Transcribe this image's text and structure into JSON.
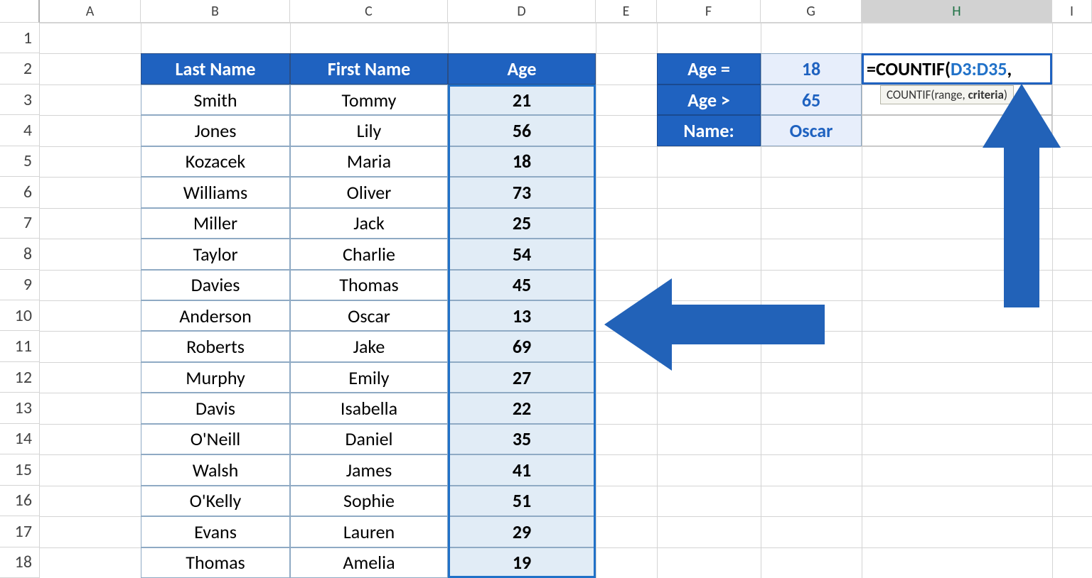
{
  "columns": {
    "A": "A",
    "B": "B",
    "C": "C",
    "D": "D",
    "E": "E",
    "F": "F",
    "G": "G",
    "H": "H",
    "I": "I"
  },
  "rows": [
    "1",
    "2",
    "3",
    "4",
    "5",
    "6",
    "7",
    "8",
    "9",
    "10",
    "11",
    "12",
    "13",
    "14",
    "15",
    "16",
    "17",
    "18"
  ],
  "main_table": {
    "headers": {
      "B": "Last Name",
      "C": "First Name",
      "D": "Age"
    },
    "rows": [
      {
        "B": "Smith",
        "C": "Tommy",
        "D": "21"
      },
      {
        "B": "Jones",
        "C": "Lily",
        "D": "56"
      },
      {
        "B": "Kozacek",
        "C": "Maria",
        "D": "18"
      },
      {
        "B": "Williams",
        "C": "Oliver",
        "D": "73"
      },
      {
        "B": "Miller",
        "C": "Jack",
        "D": "25"
      },
      {
        "B": "Taylor",
        "C": "Charlie",
        "D": "54"
      },
      {
        "B": "Davies",
        "C": "Thomas",
        "D": "45"
      },
      {
        "B": "Anderson",
        "C": "Oscar",
        "D": "13"
      },
      {
        "B": "Roberts",
        "C": "Jake",
        "D": "69"
      },
      {
        "B": "Murphy",
        "C": "Emily",
        "D": "27"
      },
      {
        "B": "Davis",
        "C": "Isabella",
        "D": "22"
      },
      {
        "B": "O'Neill",
        "C": "Daniel",
        "D": "35"
      },
      {
        "B": "Walsh",
        "C": "James",
        "D": "41"
      },
      {
        "B": "O'Kelly",
        "C": "Sophie",
        "D": "51"
      },
      {
        "B": "Evans",
        "C": "Lauren",
        "D": "29"
      },
      {
        "B": "Thomas",
        "C": "Amelia",
        "D": "19"
      }
    ]
  },
  "criteria": {
    "r1": {
      "label": "Age =",
      "value": "18"
    },
    "r2": {
      "label": "Age >",
      "value": "65"
    },
    "r3": {
      "label": "Name:",
      "value": "Oscar"
    }
  },
  "formula": {
    "prefix": "=COUNTIF(",
    "range": "D3:D35",
    "suffix": ","
  },
  "tooltip": {
    "prefix": "COUNTIF(range, ",
    "bold": "criteria",
    "suffix": ")"
  },
  "colors": {
    "header_blue": "#1f62c0",
    "age_bg": "#e1ecf6",
    "arrow": "#2262b8"
  },
  "chart_data": {
    "type": "table",
    "title": "COUNTIF demo",
    "columns": [
      "Last Name",
      "First Name",
      "Age"
    ],
    "rows": [
      [
        "Smith",
        "Tommy",
        21
      ],
      [
        "Jones",
        "Lily",
        56
      ],
      [
        "Kozacek",
        "Maria",
        18
      ],
      [
        "Williams",
        "Oliver",
        73
      ],
      [
        "Miller",
        "Jack",
        25
      ],
      [
        "Taylor",
        "Charlie",
        54
      ],
      [
        "Davies",
        "Thomas",
        45
      ],
      [
        "Anderson",
        "Oscar",
        13
      ],
      [
        "Roberts",
        "Jake",
        69
      ],
      [
        "Murphy",
        "Emily",
        27
      ],
      [
        "Davis",
        "Isabella",
        22
      ],
      [
        "O'Neill",
        "Daniel",
        35
      ],
      [
        "Walsh",
        "James",
        41
      ],
      [
        "O'Kelly",
        "Sophie",
        51
      ],
      [
        "Evans",
        "Lauren",
        29
      ],
      [
        "Thomas",
        "Amelia",
        19
      ]
    ],
    "criteria": {
      "Age =": 18,
      "Age >": 65,
      "Name:": "Oscar"
    },
    "formula_in_H2": "=COUNTIF(D3:D35,"
  }
}
